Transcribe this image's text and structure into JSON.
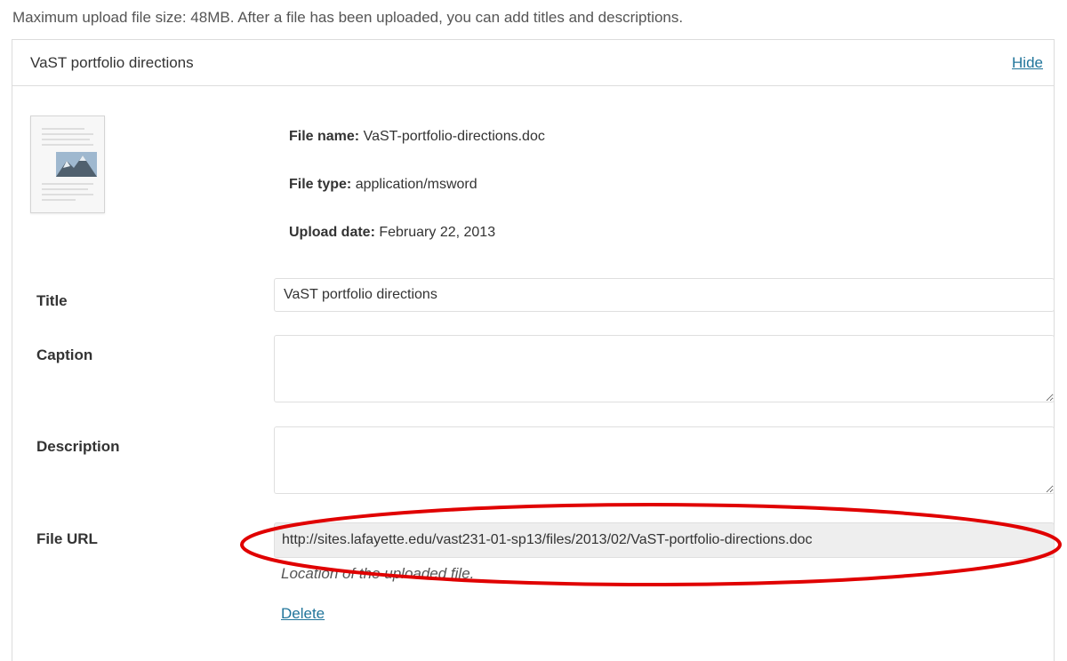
{
  "upload_note": "Maximum upload file size: 48MB. After a file has been uploaded, you can add titles and descriptions.",
  "item": {
    "title": "VaST portfolio directions",
    "hide_label": "Hide",
    "thumbnail_icon": "document-thumbnail-icon"
  },
  "meta": {
    "file_name_label": "File name:",
    "file_name_value": "VaST-portfolio-directions.doc",
    "file_type_label": "File type:",
    "file_type_value": "application/msword",
    "upload_date_label": "Upload date:",
    "upload_date_value": "February 22, 2013"
  },
  "fields": {
    "title_label": "Title",
    "title_value": "VaST portfolio directions",
    "caption_label": "Caption",
    "caption_value": "",
    "description_label": "Description",
    "description_value": "",
    "file_url_label": "File URL",
    "file_url_value": "http://sites.lafayette.edu/vast231-01-sp13/files/2013/02/VaST-portfolio-directions.doc",
    "file_url_help": "Location of the uploaded file."
  },
  "actions": {
    "delete_label": "Delete"
  },
  "colors": {
    "link": "#21759b",
    "highlight": "#e00000",
    "readonly_bg": "#eeeeee",
    "border": "#dfdfdf"
  }
}
